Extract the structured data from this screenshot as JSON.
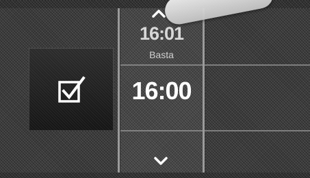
{
  "picker": {
    "next_time": "16:01",
    "caption": "Basta",
    "current_time": "16:00"
  },
  "icons": {
    "confirm": "checkbox-check-icon",
    "up": "chevron-up-icon",
    "down": "chevron-down-icon"
  },
  "colors": {
    "background": "#303030",
    "text": "#ffffff",
    "divider": "#bdbdbd"
  }
}
